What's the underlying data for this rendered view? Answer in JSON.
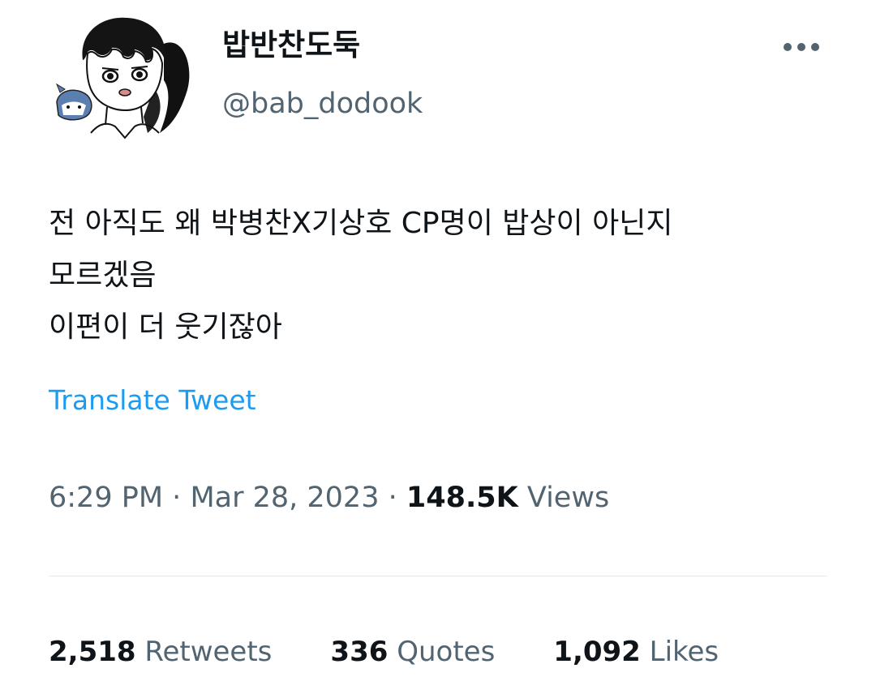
{
  "author": {
    "display_name": "밥반찬도둑",
    "handle": "@bab_dodook",
    "avatar_icon": "cartoon-avatar-icon"
  },
  "more_icon": "more-dots-icon",
  "tweet": {
    "lines": [
      "전 아직도 왜 박병찬X기상호 CP명이 밥상이 아닌지",
      "모르겠음",
      "이편이 더 웃기잖아"
    ],
    "translate_label": "Translate Tweet"
  },
  "meta": {
    "time": "6:29 PM",
    "separator": "·",
    "date": "Mar 28, 2023",
    "views_count": "148.5K",
    "views_label": "Views"
  },
  "stats": {
    "retweets_count": "2,518",
    "retweets_label": "Retweets",
    "quotes_count": "336",
    "quotes_label": "Quotes",
    "likes_count": "1,092",
    "likes_label": "Likes"
  },
  "colors": {
    "text": "#0f1419",
    "secondary": "#536471",
    "link": "#1d9bf0",
    "divider": "#e6e9ec"
  }
}
